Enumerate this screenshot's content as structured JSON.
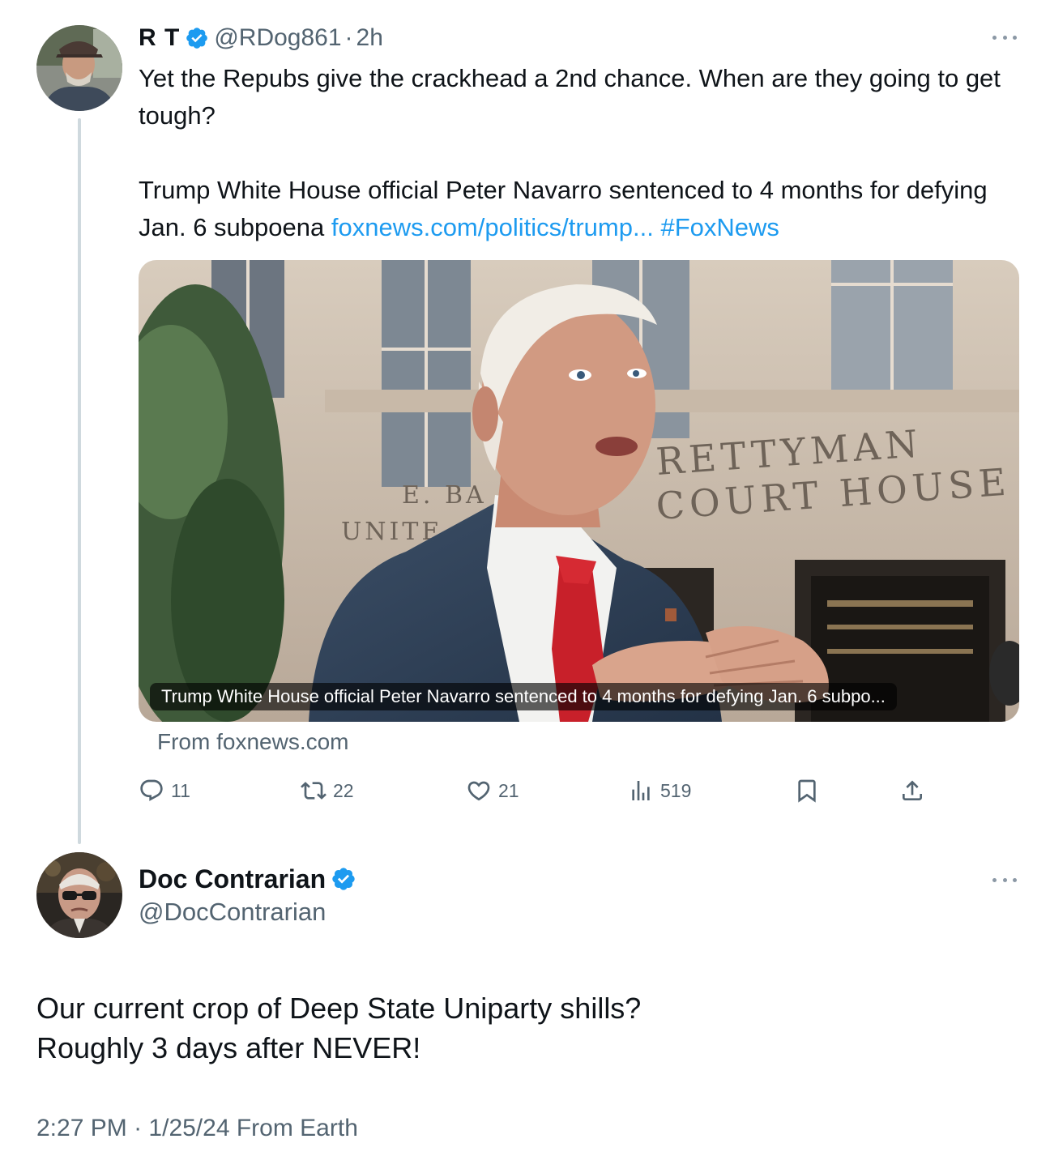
{
  "parent_tweet": {
    "name": "R T",
    "handle": "@RDog861",
    "dot": "·",
    "time": "2h",
    "text_line1": "Yet the Repubs give the crackhead a 2nd chance.  When are they going to get tough?",
    "text_line2": "Trump White House official Peter Navarro sentenced to 4 months for defying Jan. 6 subpoena ",
    "link_text": "foxnews.com/politics/trump...",
    "hashtag": "#FoxNews",
    "card": {
      "caption": "Trump White House official Peter Navarro sentenced to 4 months for defying Jan. 6 subpo...",
      "sign_line1": "RETTYMAN",
      "sign_line2": "COURT HOUSE",
      "sign_left1": "E. BA",
      "sign_left2": "UNITE"
    },
    "source": "From foxnews.com",
    "actions": {
      "replies": "11",
      "reposts": "22",
      "likes": "21",
      "views": "519"
    }
  },
  "focused_tweet": {
    "name": "Doc Contrarian",
    "handle": "@DocContrarian",
    "text_line1": "Our current crop of Deep State Uniparty shills?",
    "text_line2": "Roughly 3 days after NEVER!",
    "time": "2:27 PM",
    "dot": "·",
    "date": "1/25/24 From Earth"
  },
  "colors": {
    "accent": "#1d9bf0",
    "secondary_text": "#536471",
    "thread_line": "#cfd9de"
  }
}
